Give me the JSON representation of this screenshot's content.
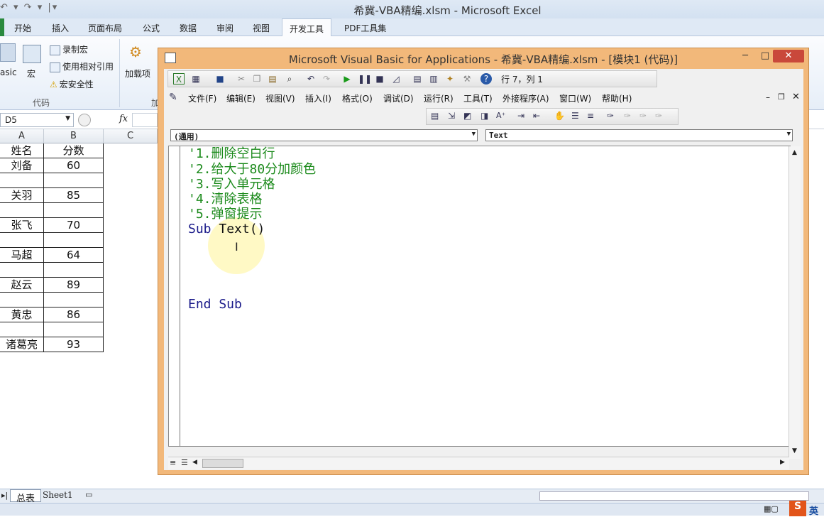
{
  "excel": {
    "title": "希冀-VBA精编.xlsm - Microsoft Excel",
    "qat": "↶ ▾ ↷ ▾ |▾",
    "tabs": [
      "开始",
      "插入",
      "页面布局",
      "公式",
      "数据",
      "审阅",
      "视图",
      "开发工具",
      "PDF工具集"
    ],
    "active_tab": "开发工具",
    "ribbon": {
      "vb_label": "asic",
      "macro_label": "宏",
      "record_macro": "录制宏",
      "relative_ref": "使用相对引用",
      "macro_security": "宏安全性",
      "group_code": "代码",
      "addins_label": "加载项",
      "group_addins": "加"
    },
    "name_box": "D5",
    "fx": "fx",
    "columns": [
      "A",
      "B",
      "C"
    ],
    "rows": [
      {
        "a": "姓名",
        "b": "分数"
      },
      {
        "a": "刘备",
        "b": "60"
      },
      {
        "a": "",
        "b": ""
      },
      {
        "a": "关羽",
        "b": "85"
      },
      {
        "a": "",
        "b": ""
      },
      {
        "a": "张飞",
        "b": "70"
      },
      {
        "a": "",
        "b": ""
      },
      {
        "a": "马超",
        "b": "64"
      },
      {
        "a": "",
        "b": ""
      },
      {
        "a": "赵云",
        "b": "89"
      },
      {
        "a": "",
        "b": ""
      },
      {
        "a": "黄忠",
        "b": "86"
      },
      {
        "a": "",
        "b": ""
      },
      {
        "a": "诸葛亮",
        "b": "93"
      }
    ],
    "sheet_tabs": [
      "总表",
      "Sheet1"
    ],
    "ime": "英"
  },
  "vbe": {
    "title": "Microsoft Visual Basic for Applications - 希冀-VBA精编.xlsm - [模块1 (代码)]",
    "position": "行 7，列 1",
    "menus": [
      "文件(F)",
      "编辑(E)",
      "视图(V)",
      "插入(I)",
      "格式(O)",
      "调试(D)",
      "运行(R)",
      "工具(T)",
      "外接程序(A)",
      "窗口(W)",
      "帮助(H)"
    ],
    "object_combo": "(通用)",
    "proc_combo": "Text",
    "code": {
      "c1": "'1.删除空白行",
      "c2": "'2.给大于80分加颜色",
      "c3": "'3.写入单元格",
      "c4": "'4.清除表格",
      "c5": "'5.弹窗提示",
      "sub_kw": "Sub",
      "sub_name": " Text()",
      "end_sub": "End Sub"
    }
  },
  "colors": {
    "accent": "#2a8a3e",
    "comment": "#1b8a1b",
    "keyword": "#1b1b8a",
    "vbe_frame": "#f2b87a"
  }
}
